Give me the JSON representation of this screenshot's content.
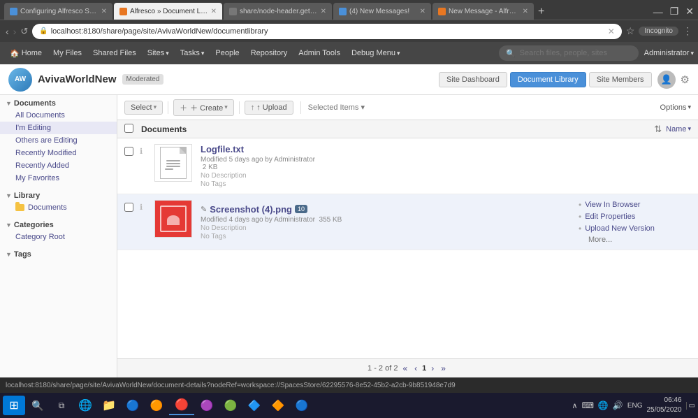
{
  "browser": {
    "tabs": [
      {
        "id": "tab1",
        "title": "Configuring Alfresco Share | Al...",
        "active": false,
        "favicon_color": "#4a90d9"
      },
      {
        "id": "tab2",
        "title": "Alfresco » Document Library",
        "active": true,
        "favicon_color": "#e87722"
      },
      {
        "id": "tab3",
        "title": "share/node-header.get.js at m...",
        "active": false,
        "favicon_color": "#555"
      },
      {
        "id": "tab4",
        "title": "(4) New Messages!",
        "active": false,
        "favicon_color": "#4a90d9"
      },
      {
        "id": "tab5",
        "title": "New Message - Alfresco Hub",
        "active": false,
        "favicon_color": "#e87722"
      }
    ],
    "address": "localhost:8180/share/page/site/AvivaWorldNew/documentlibrary",
    "incognito_label": "Incognito"
  },
  "app_nav": {
    "home_label": "Home",
    "my_files_label": "My Files",
    "shared_files_label": "Shared Files",
    "sites_label": "Sites",
    "tasks_label": "Tasks",
    "people_label": "People",
    "repository_label": "Repository",
    "admin_tools_label": "Admin Tools",
    "debug_menu_label": "Debug Menu",
    "search_placeholder": "Search files, people, sites",
    "admin_label": "Administrator"
  },
  "site_header": {
    "title": "AvivaWorldNew",
    "badge": "Moderated",
    "site_dashboard_label": "Site Dashboard",
    "document_library_label": "Document Library",
    "site_members_label": "Site Members"
  },
  "toolbar": {
    "select_label": "Select",
    "create_label": "＋ Create",
    "upload_label": "↑ Upload",
    "selected_items_label": "Selected Items ▾",
    "options_label": "Options"
  },
  "sort_bar": {
    "path": "Documents",
    "sort_icon": "⇅",
    "name_label": "Name",
    "name_arrow": "▾"
  },
  "sidebar": {
    "documents_label": "Documents",
    "all_documents_label": "All Documents",
    "im_editing_label": "I'm Editing",
    "others_editing_label": "Others are Editing",
    "recently_modified_label": "Recently Modified",
    "recently_added_label": "Recently Added",
    "my_favorites_label": "My Favorites",
    "library_label": "Library",
    "documents_folder_label": "Documents",
    "categories_label": "Categories",
    "category_root_label": "Category Root",
    "tags_label": "Tags"
  },
  "files": [
    {
      "id": "file1",
      "name": "Logfile.txt",
      "type": "text",
      "modified": "Modified 5 days ago by Administrator",
      "size": "2 KB",
      "description": "No Description",
      "tags": "No Tags",
      "actions": []
    },
    {
      "id": "file2",
      "name": "Screenshot (4).png",
      "type": "image",
      "modified": "Modified 4 days ago by Administrator",
      "size": "355 KB",
      "description": "No Description",
      "tags": "No Tags",
      "actions": [
        {
          "label": "View In Browser"
        },
        {
          "label": "Edit Properties"
        },
        {
          "label": "Upload New Version"
        },
        {
          "label": "More..."
        }
      ],
      "hovered": true
    }
  ],
  "pagination": {
    "range": "1 - 2 of 2",
    "first_label": "«",
    "prev_label": "‹",
    "page_label": "1",
    "next_label": "›",
    "last_label": "»"
  },
  "status_bar": {
    "url": "localhost:8180/share/page/site/AvivaWorldNew/document-details?nodeRef=workspace://SpacesStore/62295576-8e52-45b2-a2cb-9b851948e7d9"
  },
  "taskbar": {
    "time": "06:46",
    "date": "25/05/2020",
    "lang": "ENG"
  }
}
